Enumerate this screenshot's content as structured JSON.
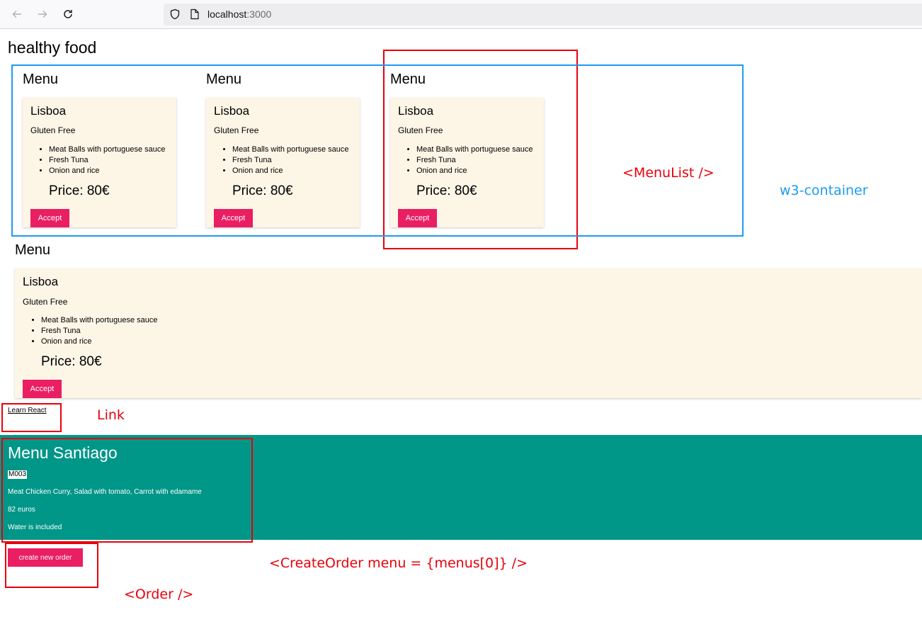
{
  "browser": {
    "url_host": "localhost",
    "url_port": ":3000"
  },
  "page": {
    "title": "healthy food"
  },
  "menu_list": [
    {
      "heading": "Menu",
      "card": {
        "name": "Lisboa",
        "diet": "Gluten Free",
        "items": [
          "Meat Balls with portuguese sauce",
          "Fresh Tuna",
          "Onion and rice"
        ],
        "price": "Price: 80€",
        "button": "Accept"
      }
    },
    {
      "heading": "Menu",
      "card": {
        "name": "Lisboa",
        "diet": "Gluten Free",
        "items": [
          "Meat Balls with portuguese sauce",
          "Fresh Tuna",
          "Onion and rice"
        ],
        "price": "Price: 80€",
        "button": "Accept"
      }
    },
    {
      "heading": "Menu",
      "card": {
        "name": "Lisboa",
        "diet": "Gluten Free",
        "items": [
          "Meat Balls with portuguese sauce",
          "Fresh Tuna",
          "Onion and rice"
        ],
        "price": "Price: 80€",
        "button": "Accept"
      }
    }
  ],
  "single_menu": {
    "heading": "Menu",
    "card": {
      "name": "Lisboa",
      "diet": "Gluten Free",
      "items": [
        "Meat Balls with portuguese sauce",
        "Fresh Tuna",
        "Onion and rice"
      ],
      "price": "Price: 80€",
      "button": "Accept"
    }
  },
  "link": {
    "label": "Learn React"
  },
  "order": {
    "title": "Menu Santiago",
    "code": "M003",
    "description": "Meat Chicken Curry, Salad with tomato, Carrot with edamame",
    "price": "82 euros",
    "note": "Water is included",
    "create_button": "create new order"
  },
  "annotations": {
    "menu_list": "<MenuList />",
    "container": "w3-container",
    "link": "Link",
    "create_order": "<CreateOrder menu = {menus[0]} />",
    "order": "<Order />",
    "red_color": "#e8000b",
    "blue_color": "#1d9bf0"
  },
  "colors": {
    "accent_button": "#e91e63",
    "teal": "#009688",
    "card_bg": "#fdf5e6"
  }
}
